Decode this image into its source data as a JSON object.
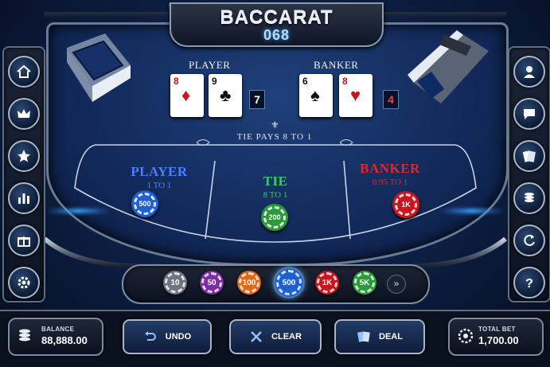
{
  "title": {
    "name": "BACCARAT",
    "number": "068"
  },
  "table": {
    "player_label": "PLAYER",
    "banker_label": "BANKER",
    "player_cards": [
      {
        "rank": "8",
        "suit": "♦",
        "color": "red"
      },
      {
        "rank": "9",
        "suit": "♣",
        "color": "black"
      }
    ],
    "banker_cards": [
      {
        "rank": "6",
        "suit": "♠",
        "color": "black"
      },
      {
        "rank": "8",
        "suit": "♥",
        "color": "red"
      }
    ],
    "player_score": "7",
    "banker_score": "4",
    "tie_pays": "TIE PAYS 8 TO 1"
  },
  "bets": {
    "player": {
      "name": "PLAYER",
      "odds": "1 TO 1",
      "chip": "500",
      "color": "#4d7dff"
    },
    "tie": {
      "name": "TIE",
      "odds": "8 TO 1",
      "chip": "200",
      "color": "#2fd15a"
    },
    "banker": {
      "name": "BANKER",
      "odds": "0.95 TO 1",
      "chip": "1K",
      "color": "#e0262e"
    }
  },
  "chip_tray": {
    "chips": [
      {
        "label": "10",
        "color": "#6e7480"
      },
      {
        "label": "50",
        "color": "#7a2ea0"
      },
      {
        "label": "100",
        "color": "#e0681c"
      },
      {
        "label": "500",
        "color": "#1f5fd1"
      },
      {
        "label": "1K",
        "color": "#c8161f"
      },
      {
        "label": "5K",
        "color": "#2a9a3a"
      }
    ],
    "selected": "500",
    "more_icon": "»"
  },
  "footer": {
    "balance_label": "BALANCE",
    "balance_value": "88,888.00",
    "undo_label": "UNDO",
    "clear_label": "CLEAR",
    "deal_label": "DEAL",
    "total_bet_label": "TOTAL BET",
    "total_bet_value": "1,700.00"
  },
  "left_menu": [
    "home-icon",
    "crown-icon",
    "star-icon",
    "bar-chart-icon",
    "gift-icon",
    "settings-icon"
  ],
  "right_menu": [
    "user-icon",
    "chat-icon",
    "cards-icon",
    "chip-stack-icon",
    "refresh-icon",
    "help-icon"
  ]
}
